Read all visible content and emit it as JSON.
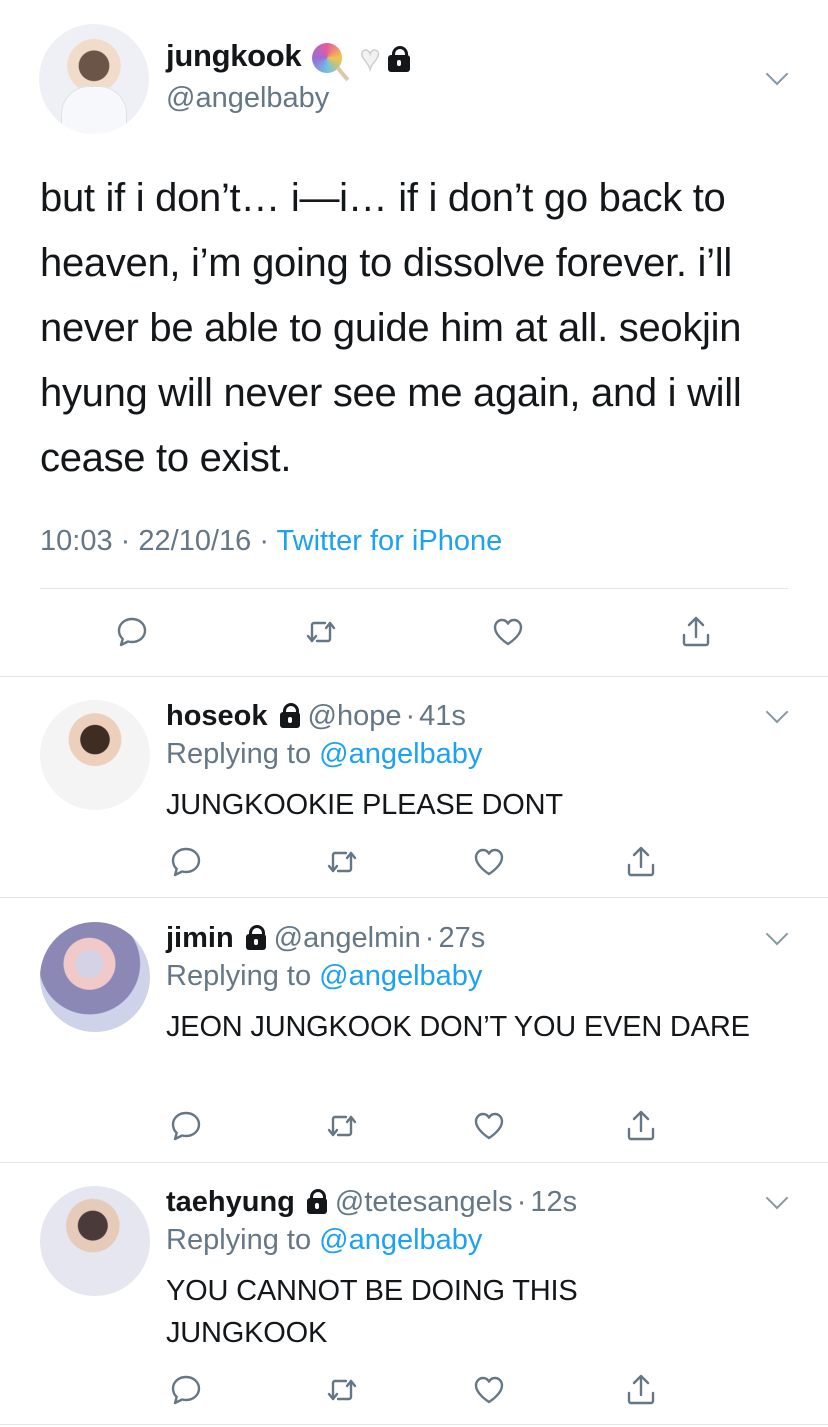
{
  "main_tweet": {
    "name": "jungkook",
    "handle": "@angelbaby",
    "emojis": [
      "lollipop-emoji",
      "white-heart-emoji"
    ],
    "text": "but if i don’t… i—i… if i don’t go back to heaven, i’m going to dissolve forever. i’ll never be able to guide him at all. seokjin hyung will never see me again, and i will cease to exist.",
    "time": "10:03",
    "date": "22/10/16",
    "separator": "·",
    "source": "Twitter for iPhone"
  },
  "icons": [
    "chevron-down-icon",
    "reply-icon",
    "retweet-icon",
    "like-icon",
    "share-icon",
    "lock-icon"
  ],
  "replies": [
    {
      "name": "hoseok",
      "handle": "@hope",
      "time": "41s",
      "replying_prefix": "Replying to",
      "replying_to": "@angelbaby",
      "text": "JUNGKOOKIE PLEASE DONT"
    },
    {
      "name": "jimin",
      "handle": "@angelmin",
      "time": "27s",
      "replying_prefix": "Replying to",
      "replying_to": "@angelbaby",
      "text": "JEON JUNGKOOK DON’T YOU EVEN DARE"
    },
    {
      "name": "taehyung",
      "handle": "@tetesangels",
      "time": "12s",
      "replying_prefix": "Replying to",
      "replying_to": "@angelbaby",
      "text": "YOU CANNOT BE DOING THIS JUNGKOOK"
    }
  ],
  "colors": {
    "text": "#14171a",
    "secondary": "#657786",
    "link": "#1da1f2",
    "divider": "#e1e8ed"
  }
}
